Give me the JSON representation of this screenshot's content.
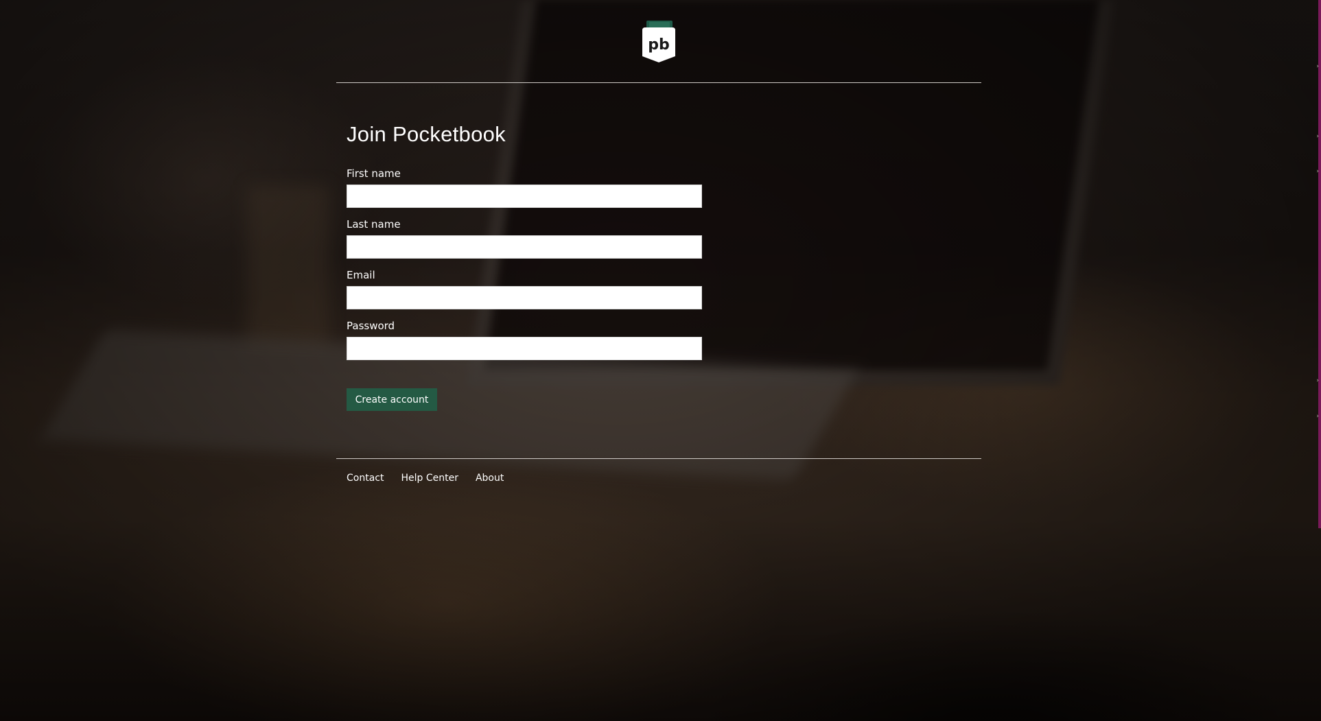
{
  "brand": {
    "logo_text": "pb",
    "logo_icon": "pocketbook-logo-icon",
    "accent_color": "#245a44"
  },
  "form": {
    "title": "Join Pocketbook",
    "fields": [
      {
        "label": "First name",
        "value": "",
        "placeholder": "",
        "type": "text"
      },
      {
        "label": "Last name",
        "value": "",
        "placeholder": "",
        "type": "text"
      },
      {
        "label": "Email",
        "value": "",
        "placeholder": "",
        "type": "email"
      },
      {
        "label": "Password",
        "value": "",
        "placeholder": "",
        "type": "password"
      }
    ],
    "submit_label": "Create account"
  },
  "footer": {
    "links": [
      "Contact",
      "Help Center",
      "About"
    ]
  }
}
